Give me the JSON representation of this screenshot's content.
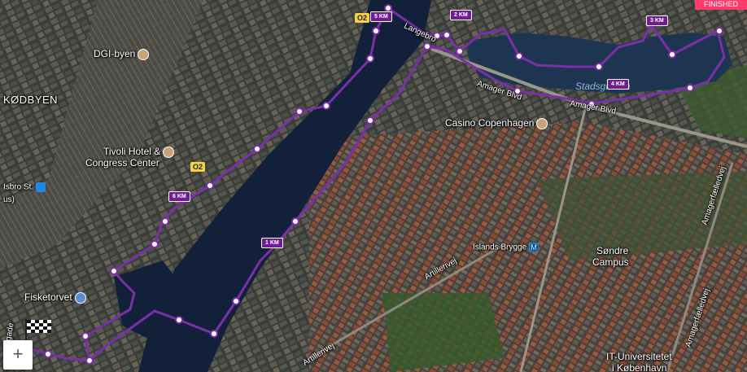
{
  "labels": {
    "kodbyen": "KØDBYEN",
    "dgi": "DGI-byen",
    "tivoli_hotel_1": "Tivoli Hotel &",
    "tivoli_hotel_2": "Congress Center",
    "isbro": "Isbro St.",
    "us": "us)",
    "fisketorvet": "Fisketorvet",
    "casino": "Casino Copenhagen",
    "islands_brygge": "Islands Brygge",
    "sondre_1": "Søndre",
    "sondre_2": "Campus",
    "it_uni_1": "IT-Universitetet",
    "it_uni_2": "i København",
    "stadsgraven": "Stadsgraven",
    "amager_blvd_1": "Amager Blvd",
    "amager_blvd_2": "Amager Blvd.",
    "artillerivej_1": "Artillerivej",
    "artillerivej_2": "Artillerivej",
    "amagerfaelledvej_1": "Amagerfælledvej",
    "amagerfaelledvej_2": "Amagerfælledvej",
    "langebro": "Langebro",
    "sbygade": "sbygade"
  },
  "road_badges": [
    "O2",
    "O2"
  ],
  "km_markers": [
    "1 KM",
    "2 KM",
    "3 KM",
    "4 KM",
    "5 KM",
    "6 KM"
  ],
  "controls": {
    "zoom_in": "+",
    "top_button": "FINISHED"
  },
  "colors": {
    "route": "#7b2fa8",
    "km_badge": "#6f1d91",
    "water": "#12203a",
    "top_button": "#ff3b6b"
  },
  "icons": {
    "poi": "poi-icon",
    "metro": "metro-icon",
    "bus": "bus-icon",
    "finish": "checkered-flag-icon"
  }
}
